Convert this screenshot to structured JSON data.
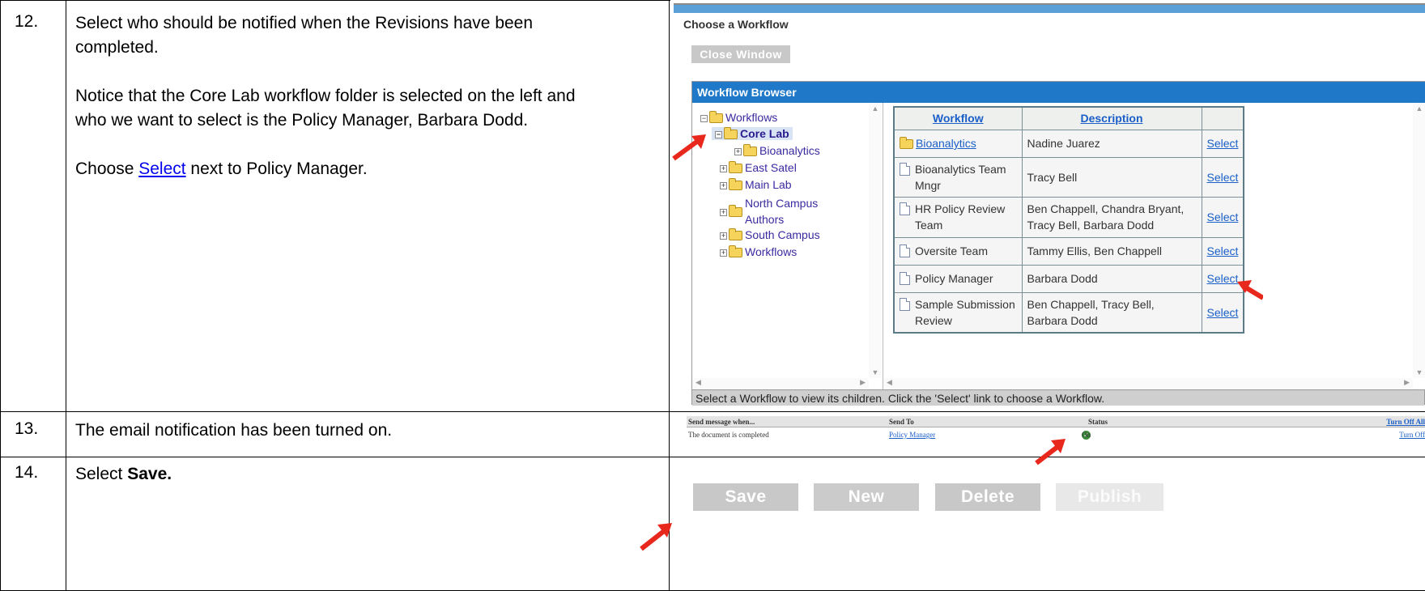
{
  "steps": [
    {
      "number": "12.",
      "line1": "Select who should be notified when the Revisions have been",
      "line2": "completed.",
      "para2_line1": "Notice that the Core Lab workflow folder is selected on the left and",
      "para2_line2": "who we want to select is the Policy Manager, Barbara Dodd.",
      "para3_before": "Choose ",
      "para3_link": "Select",
      "para3_after": " next to Policy Manager."
    },
    {
      "number": "13.",
      "text": "The email notification has been turned on."
    },
    {
      "number": "14.",
      "text_before": "Select ",
      "text_bold": "Save."
    }
  ],
  "workflow_window": {
    "title": "Choose a Workflow",
    "close_button": "Close Window",
    "browser_header": "Workflow Browser",
    "tree": [
      {
        "label": "Workflows",
        "expander": "−",
        "selected": false
      },
      {
        "label": "Core Lab",
        "expander": "−",
        "selected": true
      },
      {
        "label": "Bioanalytics",
        "expander": "+",
        "selected": false
      },
      {
        "label": "East Satel",
        "expander": "+",
        "selected": false
      },
      {
        "label": "Main Lab",
        "expander": "+",
        "selected": false
      },
      {
        "label": "North Campus",
        "label2": "Authors",
        "expander": "+",
        "selected": false
      },
      {
        "label": "South Campus",
        "expander": "+",
        "selected": false
      },
      {
        "label": "Workflows",
        "expander": "+",
        "selected": false
      }
    ],
    "columns": [
      "Workflow",
      "Description",
      ""
    ],
    "rows": [
      {
        "workflow": "Bioanalytics",
        "description": "Nadine Juarez",
        "action": "Select",
        "icon": "folder-icon"
      },
      {
        "workflow": "Bioanalytics Team Mngr",
        "description": "Tracy Bell",
        "action": "Select",
        "icon": "document-icon"
      },
      {
        "workflow": "HR Policy Review Team",
        "description": "Ben Chappell, Chandra Bryant, Tracy Bell, Barbara Dodd",
        "action": "Select",
        "icon": "document-icon"
      },
      {
        "workflow": "Oversite Team",
        "description": "Tammy Ellis, Ben Chappell",
        "action": "Select",
        "icon": "document-icon"
      },
      {
        "workflow": "Policy Manager",
        "description": "Barbara Dodd",
        "action": "Select",
        "icon": "document-icon"
      },
      {
        "workflow": "Sample Submission Review",
        "description": "Ben Chappell, Tracy Bell, Barbara Dodd",
        "action": "Select",
        "icon": "document-icon"
      }
    ],
    "status_text": "Select a Workflow to view its children. Click the 'Select' link to choose a Workflow."
  },
  "notification": {
    "headers": {
      "send_when": "Send message when...",
      "send_to": "Send To",
      "status": "Status",
      "toggle_all": "Turn Off All"
    },
    "row": {
      "send_when": "The document is completed",
      "send_to": "Policy Manager",
      "status": "On",
      "toggle": "Turn Off"
    }
  },
  "actions": {
    "save": "Save",
    "new": "New",
    "delete": "Delete",
    "publish": "Publish"
  },
  "colors": {
    "header_blue": "#1f78c8",
    "button_gray": "#c8c8c8",
    "arrow_red": "#e8281c",
    "link_blue": "#1a5ec8"
  }
}
